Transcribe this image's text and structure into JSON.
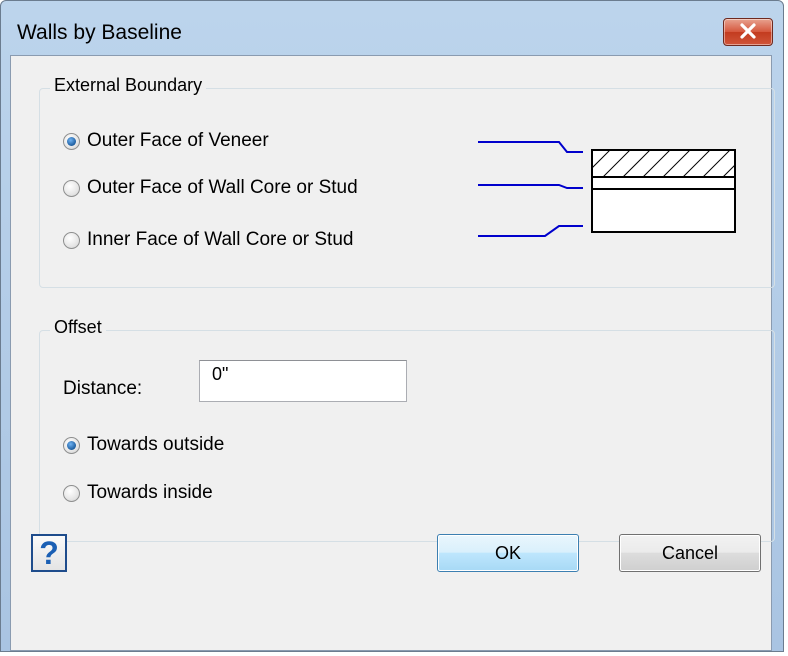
{
  "window": {
    "title": "Walls by Baseline"
  },
  "external_boundary": {
    "legend": "External Boundary",
    "options": [
      {
        "label": "Outer Face of Veneer",
        "checked": true
      },
      {
        "label": "Outer Face of Wall Core or Stud",
        "checked": false
      },
      {
        "label": "Inner Face of Wall Core or Stud",
        "checked": false
      }
    ]
  },
  "offset": {
    "legend": "Offset",
    "distance_label": "Distance:",
    "distance_value": "0\"",
    "options": [
      {
        "label": "Towards outside",
        "checked": true
      },
      {
        "label": "Towards inside",
        "checked": false
      }
    ]
  },
  "buttons": {
    "help_label": "?",
    "ok_label": "OK",
    "cancel_label": "Cancel"
  },
  "colors": {
    "baseline_line": "#0000cc",
    "title_bar": "#b4cde8",
    "close_button": "#d0553a"
  },
  "icons": [
    "close-icon",
    "help-icon",
    "wall-section-diagram"
  ]
}
